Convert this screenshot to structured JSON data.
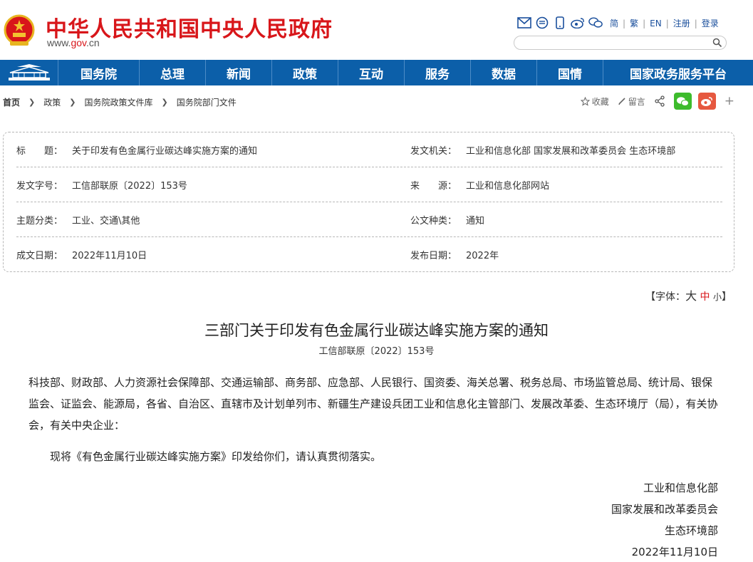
{
  "header": {
    "site_title": "中华人民共和国中央人民政府",
    "site_url_prefix": "www.",
    "site_url_brand": "gov",
    "site_url_suffix": ".cn",
    "icons": [
      "mail-icon",
      "message-icon",
      "mobile-icon",
      "weibo-icon",
      "wechat-icon"
    ],
    "links": [
      "简",
      "繁",
      "EN",
      "注册",
      "登录"
    ],
    "search_placeholder": ""
  },
  "nav": {
    "items": [
      "国务院",
      "总理",
      "新闻",
      "政策",
      "互动",
      "服务",
      "数据",
      "国情",
      "国家政务服务平台"
    ]
  },
  "breadcrumb": [
    "首页",
    "政策",
    "国务院政策文件库",
    "国务院部门文件"
  ],
  "actions": {
    "favorite": "收藏",
    "comment": "留言"
  },
  "info": {
    "title_label": "标　　题：",
    "title_value": "关于印发有色金属行业碳达峰实施方案的通知",
    "issuer_label": "发文机关：",
    "issuer_value": "工业和信息化部 国家发展和改革委员会 生态环境部",
    "docno_label": "发文字号：",
    "docno_value": "工信部联原〔2022〕153号",
    "source_label": "来　　源：",
    "source_value": "工业和信息化部网站",
    "topic_label": "主题分类：",
    "topic_value": "工业、交通\\其他",
    "type_label": "公文种类：",
    "type_value": "通知",
    "written_label": "成文日期：",
    "written_value": "2022年11月10日",
    "published_label": "发布日期：",
    "published_value": "2022年"
  },
  "font_switch": {
    "prefix": "【字体：",
    "big": "大",
    "mid": "中",
    "small": "小",
    "suffix": "】"
  },
  "article": {
    "title": "三部门关于印发有色金属行业碳达峰实施方案的通知",
    "doc_no": "工信部联原〔2022〕153号",
    "para1": "科技部、财政部、人力资源社会保障部、交通运输部、商务部、应急部、人民银行、国资委、海关总署、税务总局、市场监管总局、统计局、银保监会、证监会、能源局，各省、自治区、直辖市及计划单列市、新疆生产建设兵团工业和信息化主管部门、发展改革委、生态环境厅（局），有关协会，有关中央企业：",
    "para2": "现将《有色金属行业碳达峰实施方案》印发给你们，请认真贯彻落实。",
    "sign1": "工业和信息化部",
    "sign2": "国家发展和改革委员会",
    "sign3": "生态环境部",
    "sign_date": "2022年11月10日"
  },
  "colors": {
    "brand_red": "#d8161a",
    "nav_blue": "#0c5fa9",
    "wechat_green": "#3dbb2c",
    "weibo_red": "#e6583f"
  }
}
